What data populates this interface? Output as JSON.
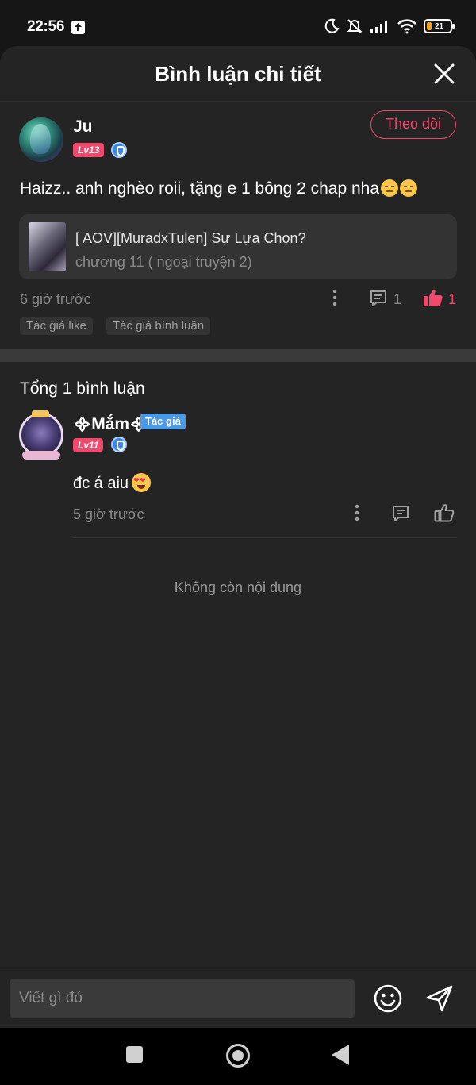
{
  "status_bar": {
    "time": "22:56",
    "battery": "21",
    "battery_level": 0.21
  },
  "header": {
    "title": "Bình luận chi tiết"
  },
  "main_comment": {
    "user_name": "Ju",
    "level": "Lv13",
    "follow_label": "Theo dõi",
    "text": "Haizz.. anh nghèo roii, tặng e 1 bông 2 chap nha",
    "story": {
      "title": "[ AOV][MuradxTulen] Sự Lựa Chọn?",
      "chapter": "chương 11 ( ngoại truyện 2)"
    },
    "time": "6 giờ trước",
    "reply_count": "1",
    "like_count": "1",
    "tags": [
      "Tác giả like",
      "Tác giả bình luận"
    ]
  },
  "replies": {
    "total_label": "Tổng 1 bình luận",
    "items": [
      {
        "user_name": "᯽Mắm᯽",
        "author_badge": "Tác giả",
        "level": "Lv11",
        "text": "đc á aiu",
        "time": "5 giờ trước"
      }
    ],
    "end_label": "Không còn nội dung"
  },
  "input": {
    "placeholder": "Viết gì đó"
  },
  "colors": {
    "accent": "#f2476b",
    "badge_blue": "#4a9ae8",
    "background": "#242424"
  }
}
